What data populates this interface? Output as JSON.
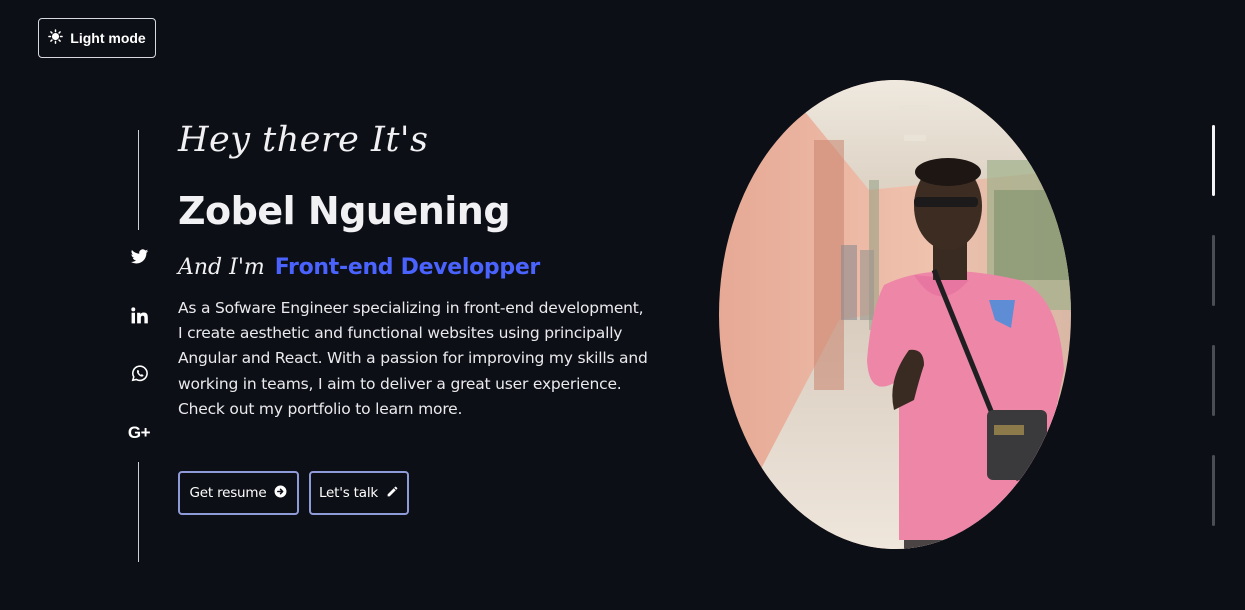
{
  "theme_toggle": {
    "label": "Light mode",
    "icon": "sun-icon"
  },
  "social": [
    {
      "name": "twitter",
      "icon": "twitter-icon"
    },
    {
      "name": "linkedin",
      "icon": "linkedin-icon"
    },
    {
      "name": "whatsapp",
      "icon": "whatsapp-icon"
    },
    {
      "name": "google-plus",
      "icon": "google-plus-icon",
      "text": "G+"
    }
  ],
  "hero": {
    "greeting": "Hey there It's",
    "name": "Zobel Nguening",
    "role_prefix": "And I'm",
    "role": "Front-end Developper",
    "bio": "As a Sofware Engineer specializing in front-end development, I create aesthetic and functional websites using principally Angular and React. With a passion for improving my skills and working in teams, I aim to deliver a great user experience. Check out my portfolio to learn more."
  },
  "buttons": {
    "resume": {
      "label": "Get resume",
      "icon": "arrow-right-circle-icon"
    },
    "talk": {
      "label": "Let's talk",
      "icon": "pencil-icon"
    }
  },
  "sections": {
    "count": 4,
    "active": 1
  },
  "colors": {
    "background": "#0d0f16",
    "accent": "#4a63ff",
    "button_border": "#8f9bd8"
  }
}
